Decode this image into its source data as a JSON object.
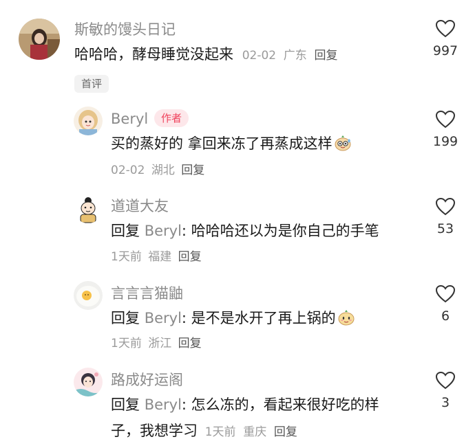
{
  "comments": [
    {
      "username": "斯敏的馒头日记",
      "text": "哈哈哈，酵母睡觉没起来",
      "date": "02-02",
      "location": "广东",
      "reply_label": "回复",
      "likes": "997",
      "badge": "首评"
    },
    {
      "username": "Beryl",
      "author_badge": "作者",
      "text": "买的蒸好的 拿回来冻了再蒸成这样",
      "emoji_icon": "sweating-bun-emoji",
      "date": "02-02",
      "location": "湖北",
      "reply_label": "回复",
      "likes": "199"
    },
    {
      "username": "道道大友",
      "reply_prefix": "回复",
      "reply_to": "Beryl",
      "text": ": 哈哈哈还以为是你自己的手笔",
      "date": "1天前",
      "location": "福建",
      "reply_label": "回复",
      "likes": "53"
    },
    {
      "username": "言言言猫鼬",
      "reply_prefix": "回复",
      "reply_to": "Beryl",
      "text": ": 是不是水开了再上锅的",
      "emoji_icon": "bun-face-emoji",
      "date": "1天前",
      "location": "浙江",
      "reply_label": "回复",
      "likes": "6"
    },
    {
      "username": "路成好运阁",
      "reply_prefix": "回复",
      "reply_to": "Beryl",
      "text": ": 怎么冻的，看起来很好吃的样",
      "text_line2": "子，我想学习",
      "date": "1天前",
      "location": "重庆",
      "reply_label": "回复",
      "likes": "3"
    }
  ],
  "icons": {
    "like": "heart-outline-icon"
  },
  "colors": {
    "author_badge_text": "#f0435d",
    "author_badge_bg": "#fde7ea",
    "username": "#8a8a8a",
    "meta": "#9a9a9a"
  }
}
